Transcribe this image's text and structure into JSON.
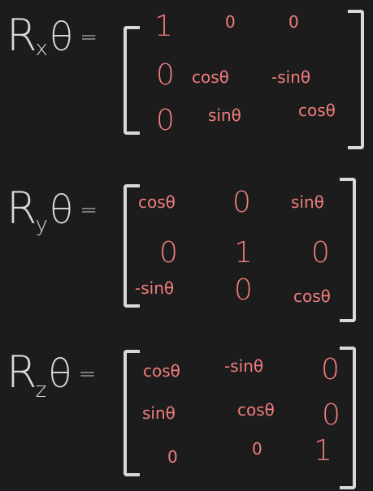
{
  "rx": {
    "R": "R",
    "subscript": "x",
    "theta": "θ",
    "equals": "=",
    "rows": [
      [
        "1",
        "0",
        "0"
      ],
      [
        "0",
        "cosθ",
        "-sinθ"
      ],
      [
        "0",
        "sinθ",
        "cosθ"
      ]
    ]
  },
  "ry": {
    "R": "R",
    "subscript": "y",
    "theta": "θ",
    "equals": "=",
    "rows": [
      [
        "cosθ",
        "0",
        "sinθ"
      ],
      [
        "0",
        "1",
        "0"
      ],
      [
        "-sinθ",
        "0",
        "cosθ"
      ]
    ]
  },
  "rz": {
    "R": "R",
    "subscript": "z",
    "theta": "θ",
    "equals": "=",
    "rows": [
      [
        "cosθ",
        "-sinθ",
        "0"
      ],
      [
        "sinθ",
        "cosθ",
        "0"
      ],
      [
        "0",
        "0",
        "1"
      ]
    ]
  },
  "colors": {
    "background": "#1c1c1c",
    "symbol": "#d9d9d9",
    "entries": "#f07d7d"
  }
}
